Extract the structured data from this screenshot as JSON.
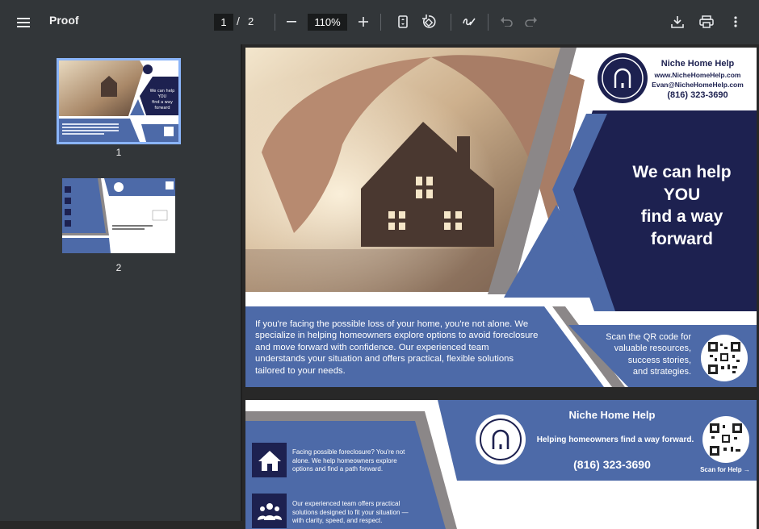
{
  "toolbar": {
    "title": "Proof",
    "current_page": "1",
    "page_separator": "/",
    "total_pages": "2",
    "zoom": "110%"
  },
  "thumbnails": [
    {
      "label": "1"
    },
    {
      "label": "2"
    }
  ],
  "page1": {
    "brand_name": "Niche Home Help",
    "website": "www.NicheHomeHelp.com",
    "email": "Evan@NicheHomeHelp.com",
    "phone": "(816) 323-3690",
    "headline": [
      "We can help",
      "YOU",
      "find a way",
      "forward"
    ],
    "body_text": "If you're facing the possible loss of your home, you're not alone. We specialize in helping homeowners explore options to avoid foreclosure and move forward with confidence. Our experienced team understands your situation and offers practical, flexible solutions tailored to your needs.",
    "qr_prompt": [
      "Scan the QR code for",
      "valuable resources,",
      "success stories,",
      "and strategies."
    ]
  },
  "page2": {
    "brand_name": "Niche Home Help",
    "tagline": "Helping homeowners find a way forward.",
    "phone": "(816) 323-3690",
    "scan_label": "Scan for Help →",
    "item1": "Facing possible foreclosure? You're not alone. We help homeowners explore options and find a path forward.",
    "item2": "Our experienced team offers practical solutions designed to fit your situation — with clarity, speed, and respect."
  },
  "colors": {
    "toolbar_bg": "#323639",
    "navy": "#1d2150",
    "blue": "#4d6aa8",
    "gray": "#8b8788",
    "thumb_outline": "#8ab4f8"
  },
  "icons": [
    "menu-icon",
    "fit-page-icon",
    "rotate-icon",
    "annotate-icon",
    "undo-icon",
    "redo-icon",
    "download-icon",
    "print-icon",
    "more-vert-icon",
    "minus-icon",
    "plus-icon",
    "house-icon",
    "people-icon",
    "arch-logo-icon",
    "qr-code-icon"
  ]
}
